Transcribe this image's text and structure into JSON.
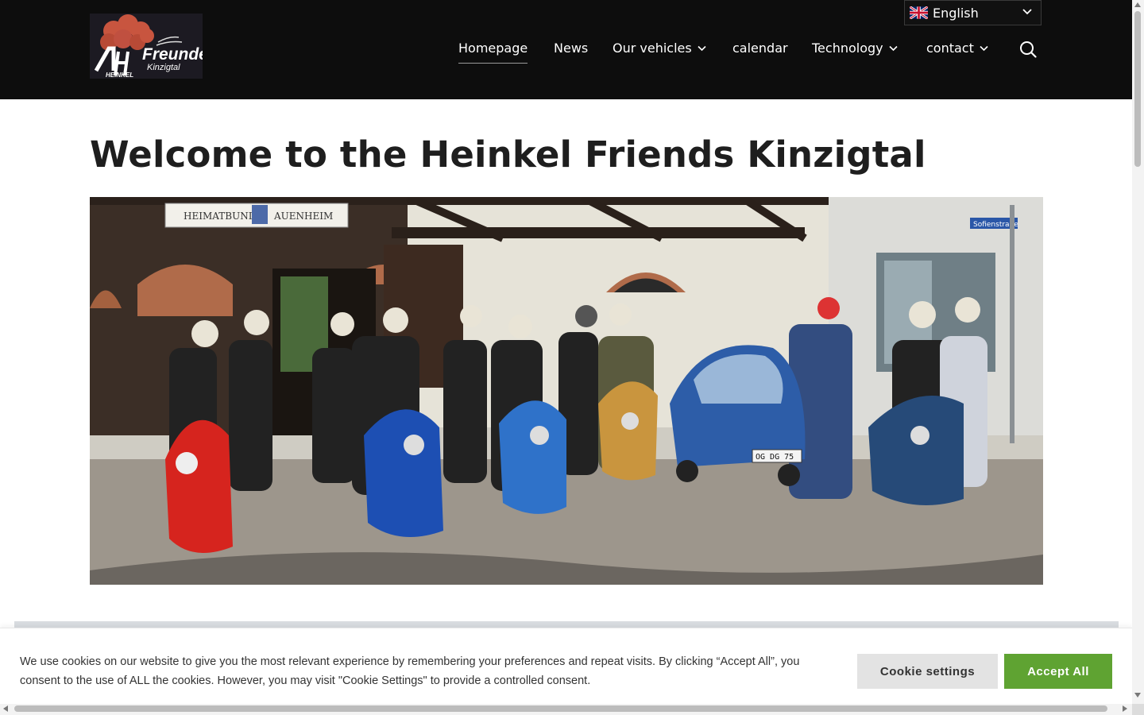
{
  "header": {
    "logo": {
      "line1": "Freunde",
      "line2": "Kinzigtal",
      "line3": "HEINKEL"
    },
    "language": {
      "label": "English",
      "flag_icon": "uk-flag-icon"
    },
    "nav": [
      {
        "label": "Homepage",
        "active": true,
        "has_submenu": false
      },
      {
        "label": "News",
        "active": false,
        "has_submenu": false
      },
      {
        "label": "Our vehicles",
        "active": false,
        "has_submenu": true
      },
      {
        "label": "calendar",
        "active": false,
        "has_submenu": false
      },
      {
        "label": "Technology",
        "active": false,
        "has_submenu": true
      },
      {
        "label": "contact",
        "active": false,
        "has_submenu": true
      }
    ],
    "search_icon": "search-icon"
  },
  "main": {
    "title": "Welcome to the Heinkel Friends Kinzigtal",
    "hero_image": {
      "sign_text_left": "HEIMATBUND",
      "sign_text_right": "AUENHEIM",
      "street_sign": "Sofienstraße",
      "plate": "OG DG 75"
    }
  },
  "cookie_banner": {
    "text": "We use cookies on our website to give you the most relevant experience by remembering your preferences and repeat visits. By clicking “Accept All”, you consent to the use of ALL the cookies. However, you may visit \"Cookie Settings\" to provide a controlled consent.",
    "settings_label": "Cookie settings",
    "accept_label": "Accept All"
  },
  "colors": {
    "header_bg": "#0d0d0d",
    "accept_green": "#5fa332",
    "settings_gray": "#e3e3e3",
    "logo_red": "#c8553f"
  }
}
